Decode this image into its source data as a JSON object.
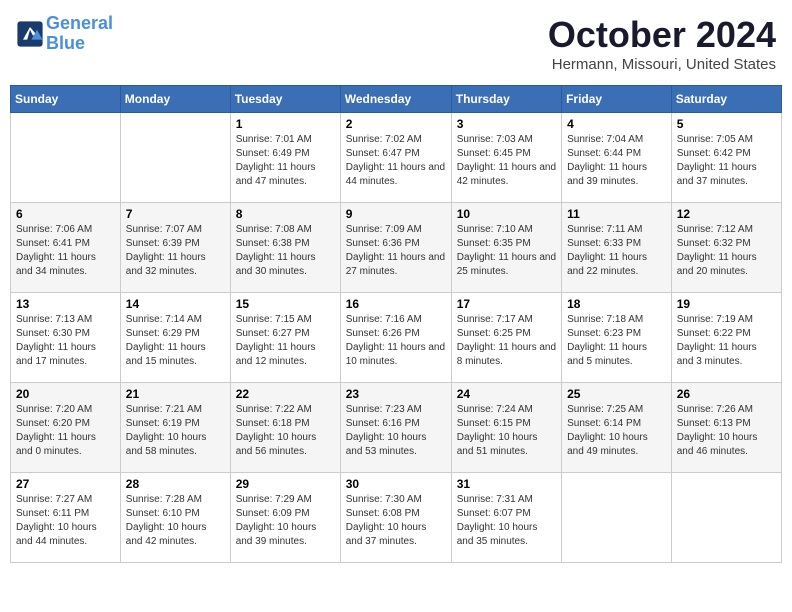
{
  "header": {
    "logo_line1": "General",
    "logo_line2": "Blue",
    "month": "October 2024",
    "location": "Hermann, Missouri, United States"
  },
  "weekdays": [
    "Sunday",
    "Monday",
    "Tuesday",
    "Wednesday",
    "Thursday",
    "Friday",
    "Saturday"
  ],
  "weeks": [
    [
      {
        "day": "",
        "sunrise": "",
        "sunset": "",
        "daylight": ""
      },
      {
        "day": "",
        "sunrise": "",
        "sunset": "",
        "daylight": ""
      },
      {
        "day": "1",
        "sunrise": "Sunrise: 7:01 AM",
        "sunset": "Sunset: 6:49 PM",
        "daylight": "Daylight: 11 hours and 47 minutes."
      },
      {
        "day": "2",
        "sunrise": "Sunrise: 7:02 AM",
        "sunset": "Sunset: 6:47 PM",
        "daylight": "Daylight: 11 hours and 44 minutes."
      },
      {
        "day": "3",
        "sunrise": "Sunrise: 7:03 AM",
        "sunset": "Sunset: 6:45 PM",
        "daylight": "Daylight: 11 hours and 42 minutes."
      },
      {
        "day": "4",
        "sunrise": "Sunrise: 7:04 AM",
        "sunset": "Sunset: 6:44 PM",
        "daylight": "Daylight: 11 hours and 39 minutes."
      },
      {
        "day": "5",
        "sunrise": "Sunrise: 7:05 AM",
        "sunset": "Sunset: 6:42 PM",
        "daylight": "Daylight: 11 hours and 37 minutes."
      }
    ],
    [
      {
        "day": "6",
        "sunrise": "Sunrise: 7:06 AM",
        "sunset": "Sunset: 6:41 PM",
        "daylight": "Daylight: 11 hours and 34 minutes."
      },
      {
        "day": "7",
        "sunrise": "Sunrise: 7:07 AM",
        "sunset": "Sunset: 6:39 PM",
        "daylight": "Daylight: 11 hours and 32 minutes."
      },
      {
        "day": "8",
        "sunrise": "Sunrise: 7:08 AM",
        "sunset": "Sunset: 6:38 PM",
        "daylight": "Daylight: 11 hours and 30 minutes."
      },
      {
        "day": "9",
        "sunrise": "Sunrise: 7:09 AM",
        "sunset": "Sunset: 6:36 PM",
        "daylight": "Daylight: 11 hours and 27 minutes."
      },
      {
        "day": "10",
        "sunrise": "Sunrise: 7:10 AM",
        "sunset": "Sunset: 6:35 PM",
        "daylight": "Daylight: 11 hours and 25 minutes."
      },
      {
        "day": "11",
        "sunrise": "Sunrise: 7:11 AM",
        "sunset": "Sunset: 6:33 PM",
        "daylight": "Daylight: 11 hours and 22 minutes."
      },
      {
        "day": "12",
        "sunrise": "Sunrise: 7:12 AM",
        "sunset": "Sunset: 6:32 PM",
        "daylight": "Daylight: 11 hours and 20 minutes."
      }
    ],
    [
      {
        "day": "13",
        "sunrise": "Sunrise: 7:13 AM",
        "sunset": "Sunset: 6:30 PM",
        "daylight": "Daylight: 11 hours and 17 minutes."
      },
      {
        "day": "14",
        "sunrise": "Sunrise: 7:14 AM",
        "sunset": "Sunset: 6:29 PM",
        "daylight": "Daylight: 11 hours and 15 minutes."
      },
      {
        "day": "15",
        "sunrise": "Sunrise: 7:15 AM",
        "sunset": "Sunset: 6:27 PM",
        "daylight": "Daylight: 11 hours and 12 minutes."
      },
      {
        "day": "16",
        "sunrise": "Sunrise: 7:16 AM",
        "sunset": "Sunset: 6:26 PM",
        "daylight": "Daylight: 11 hours and 10 minutes."
      },
      {
        "day": "17",
        "sunrise": "Sunrise: 7:17 AM",
        "sunset": "Sunset: 6:25 PM",
        "daylight": "Daylight: 11 hours and 8 minutes."
      },
      {
        "day": "18",
        "sunrise": "Sunrise: 7:18 AM",
        "sunset": "Sunset: 6:23 PM",
        "daylight": "Daylight: 11 hours and 5 minutes."
      },
      {
        "day": "19",
        "sunrise": "Sunrise: 7:19 AM",
        "sunset": "Sunset: 6:22 PM",
        "daylight": "Daylight: 11 hours and 3 minutes."
      }
    ],
    [
      {
        "day": "20",
        "sunrise": "Sunrise: 7:20 AM",
        "sunset": "Sunset: 6:20 PM",
        "daylight": "Daylight: 11 hours and 0 minutes."
      },
      {
        "day": "21",
        "sunrise": "Sunrise: 7:21 AM",
        "sunset": "Sunset: 6:19 PM",
        "daylight": "Daylight: 10 hours and 58 minutes."
      },
      {
        "day": "22",
        "sunrise": "Sunrise: 7:22 AM",
        "sunset": "Sunset: 6:18 PM",
        "daylight": "Daylight: 10 hours and 56 minutes."
      },
      {
        "day": "23",
        "sunrise": "Sunrise: 7:23 AM",
        "sunset": "Sunset: 6:16 PM",
        "daylight": "Daylight: 10 hours and 53 minutes."
      },
      {
        "day": "24",
        "sunrise": "Sunrise: 7:24 AM",
        "sunset": "Sunset: 6:15 PM",
        "daylight": "Daylight: 10 hours and 51 minutes."
      },
      {
        "day": "25",
        "sunrise": "Sunrise: 7:25 AM",
        "sunset": "Sunset: 6:14 PM",
        "daylight": "Daylight: 10 hours and 49 minutes."
      },
      {
        "day": "26",
        "sunrise": "Sunrise: 7:26 AM",
        "sunset": "Sunset: 6:13 PM",
        "daylight": "Daylight: 10 hours and 46 minutes."
      }
    ],
    [
      {
        "day": "27",
        "sunrise": "Sunrise: 7:27 AM",
        "sunset": "Sunset: 6:11 PM",
        "daylight": "Daylight: 10 hours and 44 minutes."
      },
      {
        "day": "28",
        "sunrise": "Sunrise: 7:28 AM",
        "sunset": "Sunset: 6:10 PM",
        "daylight": "Daylight: 10 hours and 42 minutes."
      },
      {
        "day": "29",
        "sunrise": "Sunrise: 7:29 AM",
        "sunset": "Sunset: 6:09 PM",
        "daylight": "Daylight: 10 hours and 39 minutes."
      },
      {
        "day": "30",
        "sunrise": "Sunrise: 7:30 AM",
        "sunset": "Sunset: 6:08 PM",
        "daylight": "Daylight: 10 hours and 37 minutes."
      },
      {
        "day": "31",
        "sunrise": "Sunrise: 7:31 AM",
        "sunset": "Sunset: 6:07 PM",
        "daylight": "Daylight: 10 hours and 35 minutes."
      },
      {
        "day": "",
        "sunrise": "",
        "sunset": "",
        "daylight": ""
      },
      {
        "day": "",
        "sunrise": "",
        "sunset": "",
        "daylight": ""
      }
    ]
  ]
}
